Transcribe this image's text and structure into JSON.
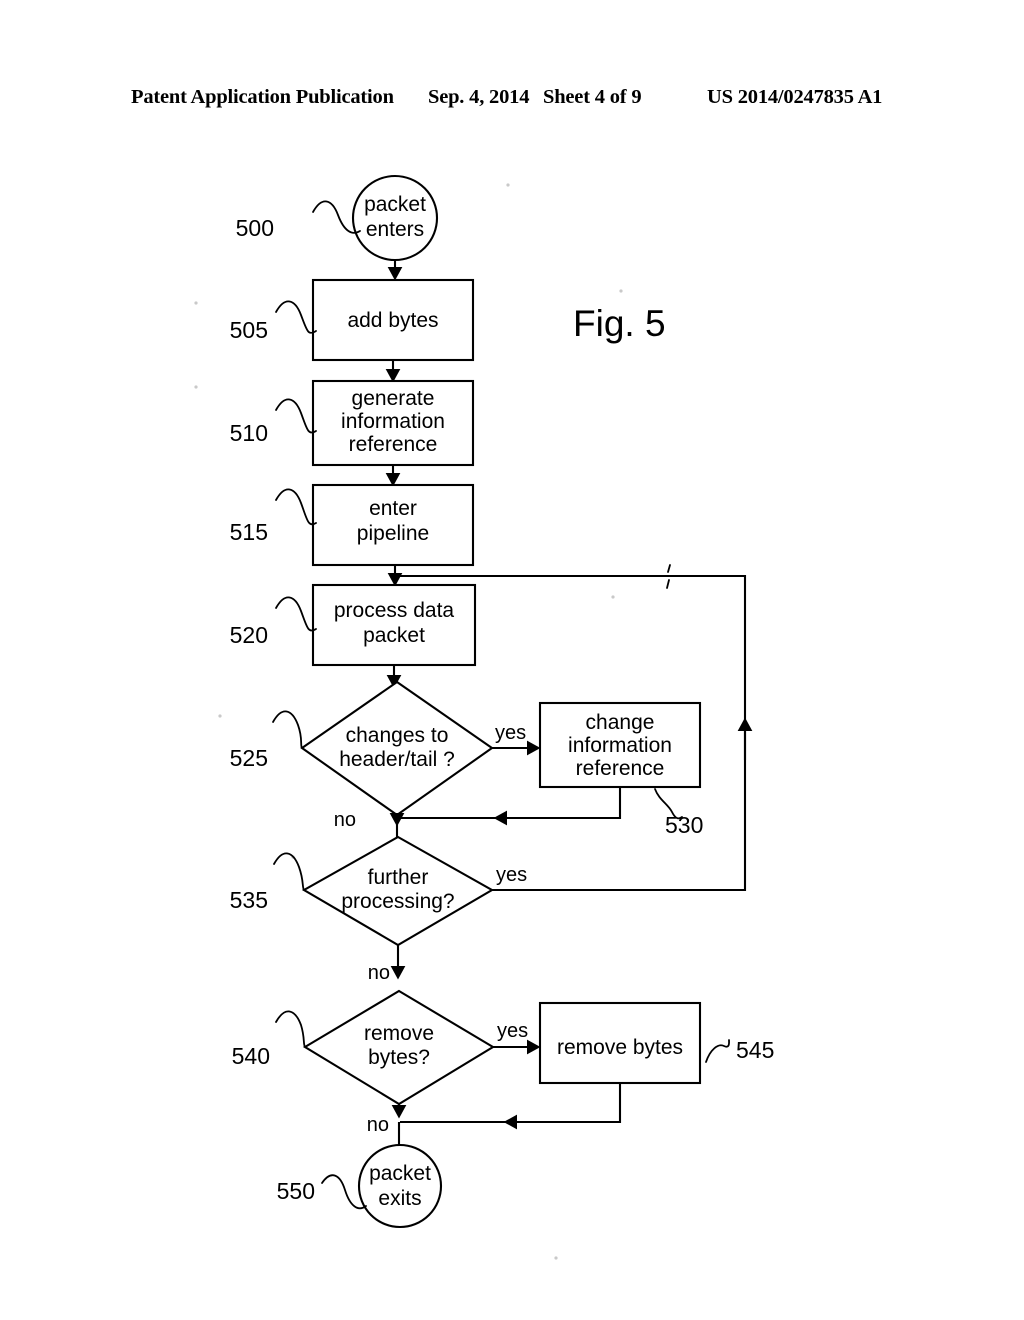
{
  "header": {
    "publication": "Patent Application Publication",
    "date": "Sep. 4, 2014",
    "sheet": "Sheet 4 of 9",
    "patent_number": "US 2014/0247835 A1"
  },
  "figure": {
    "title": "Fig. 5",
    "type": "flowchart",
    "nodes": [
      {
        "ref": "500",
        "shape": "circle",
        "lines": [
          "packet",
          "enters"
        ]
      },
      {
        "ref": "505",
        "shape": "rect",
        "lines": [
          "add bytes"
        ]
      },
      {
        "ref": "510",
        "shape": "rect",
        "lines": [
          "generate",
          "information",
          "reference"
        ]
      },
      {
        "ref": "515",
        "shape": "rect",
        "lines": [
          "enter",
          "pipeline"
        ]
      },
      {
        "ref": "520",
        "shape": "rect",
        "lines": [
          "process data",
          "packet"
        ]
      },
      {
        "ref": "525",
        "shape": "diamond",
        "lines": [
          "changes to",
          "header/tail ?"
        ]
      },
      {
        "ref": "530",
        "shape": "rect",
        "lines": [
          "change",
          "information",
          "reference"
        ]
      },
      {
        "ref": "535",
        "shape": "diamond",
        "lines": [
          "further",
          "processing?"
        ]
      },
      {
        "ref": "540",
        "shape": "diamond",
        "lines": [
          "remove",
          "bytes?"
        ]
      },
      {
        "ref": "545",
        "shape": "rect",
        "lines": [
          "remove bytes"
        ]
      },
      {
        "ref": "550",
        "shape": "circle",
        "lines": [
          "packet",
          "exits"
        ]
      }
    ],
    "edge_labels": {
      "yes_525": "yes",
      "no_525": "no",
      "yes_535": "yes",
      "no_535": "no",
      "yes_540": "yes",
      "no_540": "no"
    }
  }
}
